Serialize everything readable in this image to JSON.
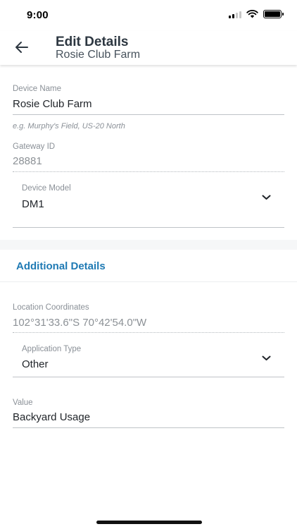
{
  "status_bar": {
    "time": "9:00"
  },
  "header": {
    "back_icon": "arrow-left-icon",
    "title": "Edit Details",
    "subtitle": "Rosie Club Farm"
  },
  "form": {
    "device_name": {
      "label": "Device Name",
      "value": "Rosie Club Farm",
      "hint": "e.g. Murphy's Field, US-20 North"
    },
    "gateway_id": {
      "label": "Gateway ID",
      "value": "28881"
    },
    "device_model": {
      "label": "Device Model",
      "value": "DM1",
      "icon": "chevron-down-icon"
    }
  },
  "additional": {
    "section_title": "Additional Details",
    "location": {
      "label": "Location Coordinates",
      "value": "102°31'33.6\"S 70°42'54.0\"W"
    },
    "application_type": {
      "label": "Application Type",
      "value": "Other",
      "icon": "chevron-down-icon"
    },
    "value_field": {
      "label": "Value",
      "value": "Backyard Usage"
    }
  },
  "colors": {
    "accent": "#1f7ab4",
    "title_text": "#2d3741",
    "label_text": "#8a9097"
  }
}
